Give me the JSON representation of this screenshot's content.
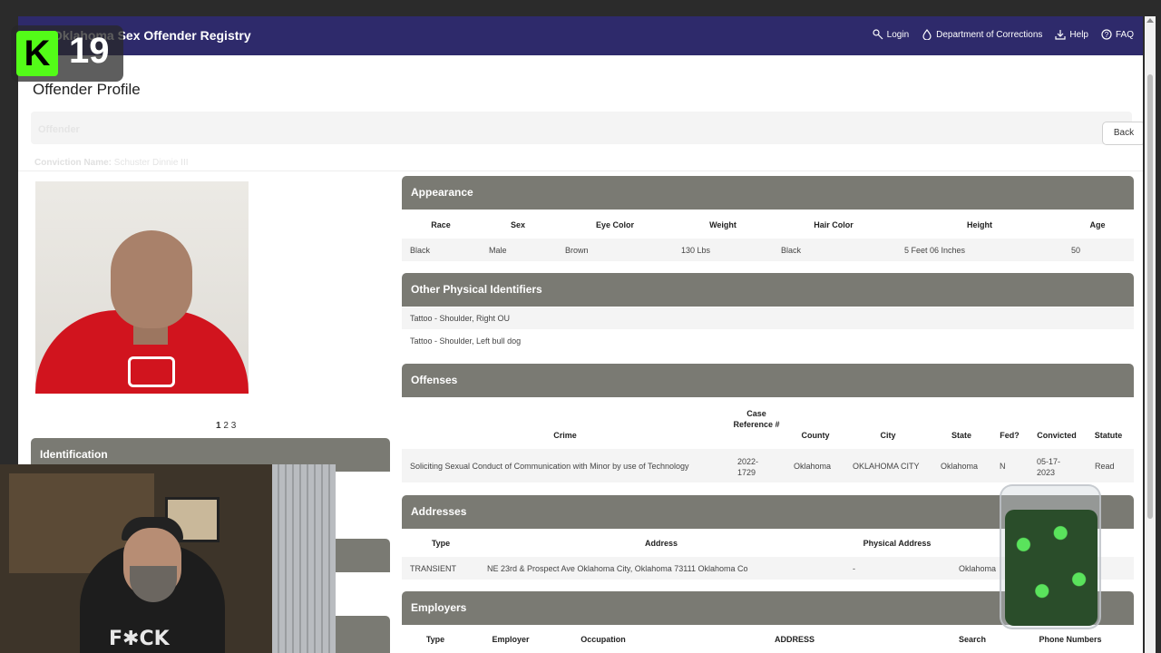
{
  "navbar": {
    "brand": "Oklahoma Sex Offender Registry",
    "links": [
      "Login",
      "Department of Corrections",
      "Help",
      "FAQ"
    ]
  },
  "page_title": "Offender Profile",
  "offender_band_label": "Offender",
  "back_label": "Back",
  "conviction": {
    "label": "Conviction Name:",
    "value": "Schuster Dinnie III"
  },
  "pager": {
    "current": "1",
    "others": [
      "2",
      "3"
    ]
  },
  "identification_label": "Identification",
  "appearance": {
    "title": "Appearance",
    "headers": [
      "Race",
      "Sex",
      "Eye Color",
      "Weight",
      "Hair Color",
      "Height",
      "Age"
    ],
    "row": [
      "Black",
      "Male",
      "Brown",
      "130 Lbs",
      "Black",
      "5 Feet 06 Inches",
      "50"
    ]
  },
  "identifiers": {
    "title": "Other Physical Identifiers",
    "rows": [
      "Tattoo - Shoulder, Right OU",
      "Tattoo - Shoulder, Left bull dog"
    ]
  },
  "offenses": {
    "title": "Offenses",
    "headers": [
      "Crime",
      "Case Reference #",
      "County",
      "City",
      "State",
      "Fed?",
      "Convicted",
      "Statute"
    ],
    "row": [
      "Soliciting Sexual Conduct of Communication with Minor by use of Technology",
      "2022-1729",
      "Oklahoma",
      "OKLAHOMA CITY",
      "Oklahoma",
      "N",
      "05-17-2023",
      "Read"
    ]
  },
  "addresses": {
    "title": "Addresses",
    "headers": [
      "Type",
      "Address",
      "Physical Address"
    ],
    "row": [
      "TRANSIENT",
      "NE 23rd & Prospect Ave Oklahoma City, Oklahoma 73111 Oklahoma Co",
      "-",
      "Oklahoma"
    ]
  },
  "employers": {
    "title": "Employers",
    "headers": [
      "Type",
      "Employer",
      "Occupation",
      "ADDRESS",
      "Search",
      "Phone Numbers"
    ]
  },
  "overlay": {
    "badge": "K",
    "number": "19",
    "shirt_text": "F✱CK"
  },
  "colors": {
    "navbar": "#2e2a6b",
    "card_header": "#7a7a73",
    "kick_green": "#53fc18"
  }
}
